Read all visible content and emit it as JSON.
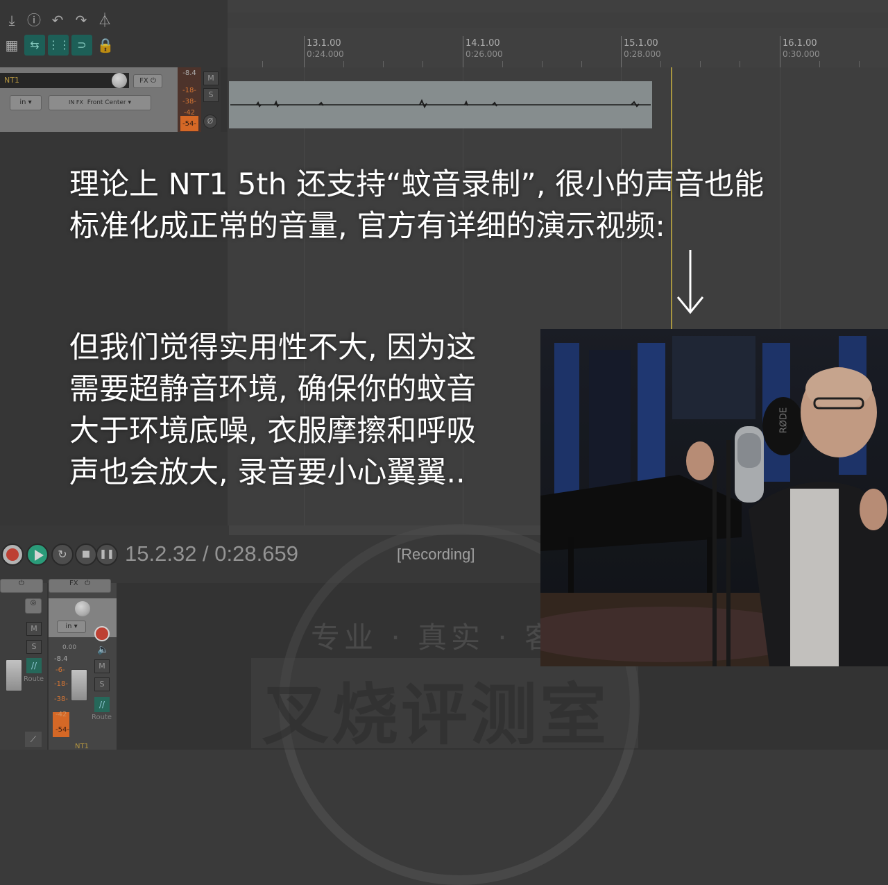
{
  "timeline": {
    "markers": [
      {
        "measure": "13.1.00",
        "time": "0:24.000"
      },
      {
        "measure": "14.1.00",
        "time": "0:26.000"
      },
      {
        "measure": "15.1.00",
        "time": "0:28.000"
      },
      {
        "measure": "16.1.00",
        "time": "0:30.000"
      }
    ]
  },
  "track": {
    "name": "NT1",
    "fx_label": "FX",
    "input_label": "in",
    "input_fx_label": "IN FX",
    "channel": "Front Center",
    "meter_levels": [
      "-8.4",
      "-18-",
      "-38-",
      "-42",
      "-54-"
    ],
    "mute_label": "M",
    "solo_label": "S",
    "phase_label": "Ø"
  },
  "captions": {
    "line1": "理论上 NT1 5th 还支持“蚊音录制”, 很小的声音也能",
    "line2": "标准化成正常的音量, 官方有详细的演示视频:",
    "para2": [
      "但我们觉得实用性不大, 因为这",
      "需要超静音环境, 确保你的蚊音",
      "大于环境底噪, 衣服摩擦和呼吸",
      "声也会放大, 录音要小心翼翼.."
    ]
  },
  "transport": {
    "time_display": "15.2.32 / 0:28.659",
    "status": "[Recording]"
  },
  "mixer": {
    "fx_label": "FX",
    "input_label": "in",
    "volume": "0.00",
    "meter_levels": [
      "-8.4",
      "-6-",
      "-18-",
      "-38-",
      "-42",
      "-54-"
    ],
    "mute_label": "M",
    "solo_label": "S",
    "route_label": "Route",
    "track_name": "NT1"
  },
  "watermark": {
    "middle": "专业 · 真实 · 客",
    "big": "叉烧评测室"
  },
  "video": {
    "mic_brand": "RØDE"
  }
}
